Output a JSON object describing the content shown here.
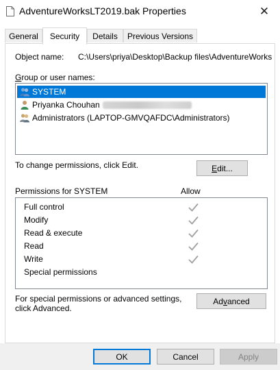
{
  "window": {
    "title": "AdventureWorksLT2019.bak Properties",
    "close_glyph": "✕"
  },
  "tabs": [
    {
      "label": "General",
      "active": false
    },
    {
      "label": "Security",
      "active": true
    },
    {
      "label": "Details",
      "active": false
    },
    {
      "label": "Previous Versions",
      "active": false
    }
  ],
  "security": {
    "object_name_label": "Object name:",
    "object_name_value": "C:\\Users\\priya\\Desktop\\Backup files\\AdventureWorks",
    "group_label": "Group or user names:",
    "users": [
      {
        "name": "SYSTEM",
        "selected": true,
        "icon": "users-group-icon"
      },
      {
        "name": "Priyanka Chouhan",
        "selected": false,
        "icon": "user-icon",
        "redacted": true
      },
      {
        "name": "Administrators (LAPTOP-GMVQAFDC\\Administrators)",
        "selected": false,
        "icon": "users-group-icon"
      }
    ],
    "change_hint": "To change permissions, click Edit.",
    "edit_button": {
      "pre": "",
      "acc": "E",
      "post": "dit..."
    },
    "permissions_label": "Permissions for SYSTEM",
    "allow_label": "Allow",
    "permissions": [
      {
        "name": "Full control",
        "allow": true
      },
      {
        "name": "Modify",
        "allow": true
      },
      {
        "name": "Read & execute",
        "allow": true
      },
      {
        "name": "Read",
        "allow": true
      },
      {
        "name": "Write",
        "allow": true
      },
      {
        "name": "Special permissions",
        "allow": false
      }
    ],
    "advanced_hint_line1": "For special permissions or advanced settings,",
    "advanced_hint_line2": "click Advanced.",
    "advanced_button": {
      "pre": "Ad",
      "acc": "v",
      "post": "anced"
    }
  },
  "footer": {
    "ok_label": "OK",
    "cancel_label": "Cancel",
    "apply_label": "Apply"
  },
  "colors": {
    "selection": "#0078d7",
    "check": "#a0a0a0",
    "footer_bg": "#f0f0f0"
  }
}
